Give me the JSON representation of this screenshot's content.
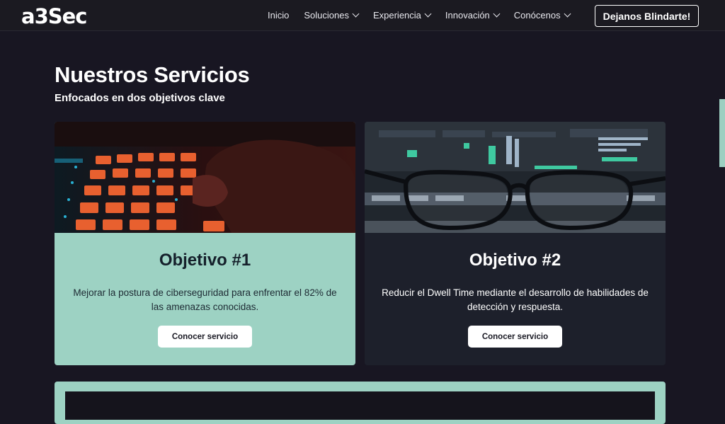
{
  "nav": {
    "logo": "a3Sec",
    "items": [
      {
        "label": "Inicio",
        "dropdown": false
      },
      {
        "label": "Soluciones",
        "dropdown": true
      },
      {
        "label": "Experiencia",
        "dropdown": true
      },
      {
        "label": "Innovación",
        "dropdown": true
      },
      {
        "label": "Conócenos",
        "dropdown": true
      }
    ],
    "cta": "Dejanos Blindarte!"
  },
  "section": {
    "title": "Nuestros Servicios",
    "subtitle": "Enfocados en dos objetivos clave"
  },
  "cards": [
    {
      "title": "Objetivo #1",
      "text": "Mejorar la postura de ciberseguridad para enfrentar el 82% de las amenazas conocidas.",
      "button": "Conocer servicio"
    },
    {
      "title": "Objetivo #2",
      "text": "Reducir el Dwell Time mediante el desarrollo de habilidades de detección y respuesta.",
      "button": "Conocer servicio"
    }
  ],
  "colors": {
    "background": "#181622",
    "accent": "#9dd2c3",
    "card_dark": "#1d202b"
  }
}
